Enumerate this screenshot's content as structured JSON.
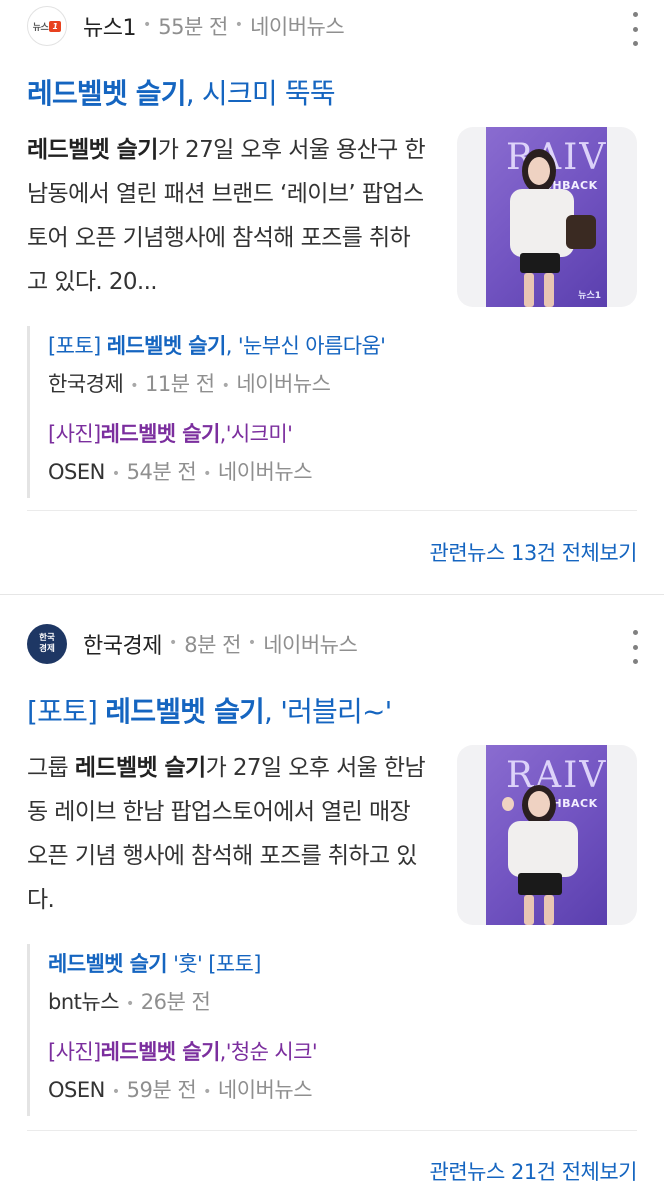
{
  "articles": [
    {
      "press": {
        "name": "뉴스1",
        "logo_text_1": "뉴스",
        "logo_text_2": "1"
      },
      "time": "55분 전",
      "source": "네이버뉴스",
      "headline_bold": "레드벨벳 슬기",
      "headline_rest": ", 시크미 뚝뚝",
      "summary_bold": "레드벨벳 슬기",
      "summary_rest": "가 27일 오후 서울 용산구 한남동에서 열린 패션 브랜드 ‘레이브’ 팝업스토어 오픈 기념행사에 참석해 포즈를 취하고 있다. 20...",
      "thumb": {
        "brand": "RAIV",
        "sub": "SHBACK",
        "watermark": "뉴스1"
      },
      "related": [
        {
          "prefix": "[포토] ",
          "bold": "레드벨벳 슬기",
          "suffix": ", '눈부신 아름다움'",
          "color": "blue",
          "press": "한국경제",
          "time": "11분 전",
          "source": "네이버뉴스"
        },
        {
          "prefix": "[사진]",
          "bold": "레드벨벳 슬기",
          "suffix": ",'시크미'",
          "color": "purple",
          "press": "OSEN",
          "time": "54분 전",
          "source": "네이버뉴스"
        }
      ],
      "more": "관련뉴스 13건 전체보기"
    },
    {
      "press": {
        "name": "한국경제",
        "logo_text_1": "한국",
        "logo_text_2": "경제"
      },
      "time": "8분 전",
      "source": "네이버뉴스",
      "headline_prefix": "[포토] ",
      "headline_bold": "레드벨벳 슬기",
      "headline_rest": ", '러블리~'",
      "summary_pre": "그룹 ",
      "summary_bold": "레드벨벳 슬기",
      "summary_rest": "가 27일 오후 서울 한남동 레이브 한남 팝업스토어에서 열린 매장 오픈 기념 행사에 참석해 포즈를 취하고 있다.",
      "thumb": {
        "brand": "RAIV",
        "sub": "SHBACK",
        "watermark": ""
      },
      "related": [
        {
          "prefix": "",
          "bold": "레드벨벳 슬기",
          "suffix": " '훗' [포토]",
          "color": "blue",
          "press": "bnt뉴스",
          "time": "26분 전",
          "source": ""
        },
        {
          "prefix": "[사진]",
          "bold": "레드벨벳 슬기",
          "suffix": ",'청순 시크'",
          "color": "purple",
          "press": "OSEN",
          "time": "59분 전",
          "source": "네이버뉴스"
        }
      ],
      "more": "관련뉴스 21건 전체보기"
    }
  ]
}
